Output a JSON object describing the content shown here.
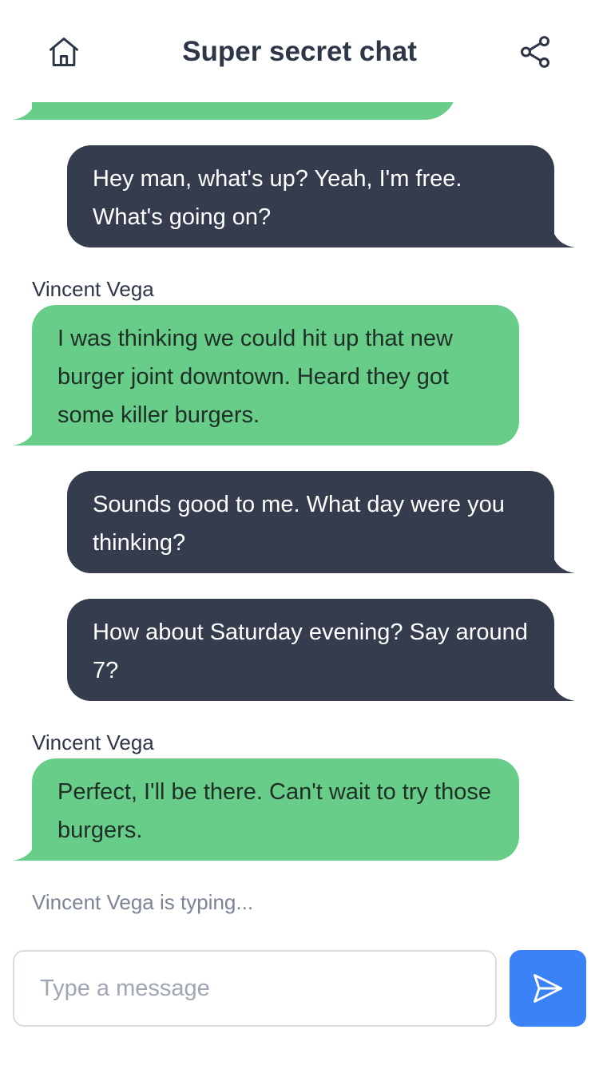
{
  "header": {
    "title": "Super secret chat",
    "home_icon": "home-icon",
    "share_icon": "share-icon"
  },
  "messages": [
    {
      "type": "recv",
      "sender": "",
      "text": ""
    },
    {
      "type": "sent",
      "text": "Hey man, what's up? Yeah, I'm free. What's going on?"
    },
    {
      "type": "recv",
      "sender": "Vincent Vega",
      "text": "I was thinking we could hit up that new burger joint downtown. Heard they got some killer burgers."
    },
    {
      "type": "sent",
      "text": "Sounds good to me. What day were you thinking?"
    },
    {
      "type": "sent",
      "text": "How about Saturday evening? Say around 7?"
    },
    {
      "type": "recv",
      "sender": "Vincent Vega",
      "text": "Perfect, I'll be there. Can't wait to try those burgers."
    }
  ],
  "typing_indicator": "Vincent Vega is typing...",
  "composer": {
    "placeholder": "Type a message",
    "value": "",
    "send_icon": "send-icon"
  },
  "colors": {
    "sent_bubble": "#343c4d",
    "received_bubble": "#68cd88",
    "send_button": "#3b82f6"
  }
}
